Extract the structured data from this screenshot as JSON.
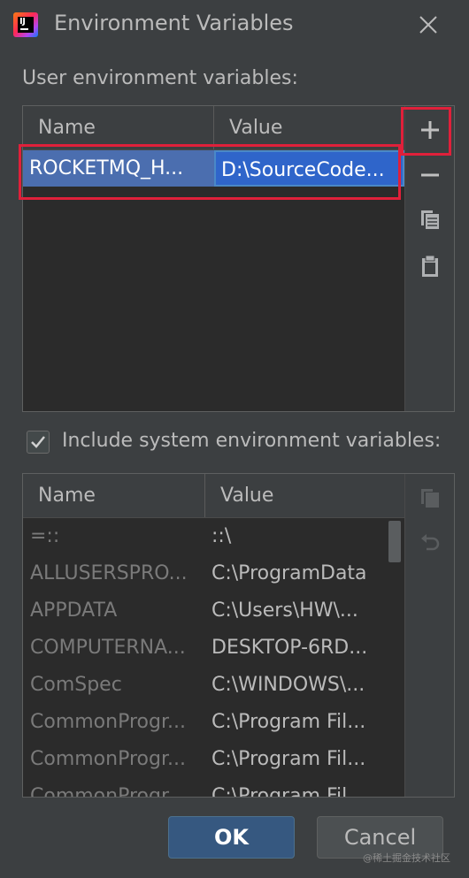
{
  "window": {
    "title": "Environment Variables",
    "logo_text": "IJ"
  },
  "user_section": {
    "label": "User environment variables:",
    "columns": [
      "Name",
      "Value"
    ],
    "rows": [
      {
        "name": "ROCKETMQ_H...",
        "value": "D:\\SourceCode..."
      }
    ]
  },
  "toolbar_icons": [
    "add-icon",
    "remove-icon",
    "copy-icon",
    "paste-icon"
  ],
  "include_system": {
    "label": "Include system environment variables:",
    "checked": true
  },
  "system_section": {
    "columns": [
      "Name",
      "Value"
    ],
    "rows": [
      {
        "name": "=::",
        "value": "::\\"
      },
      {
        "name": "ALLUSERSPRO...",
        "value": "C:\\ProgramData"
      },
      {
        "name": "APPDATA",
        "value": "C:\\Users\\HW\\..."
      },
      {
        "name": "COMPUTERNA...",
        "value": "DESKTOP-6RD..."
      },
      {
        "name": "ComSpec",
        "value": "C:\\WINDOWS\\..."
      },
      {
        "name": "CommonProgr...",
        "value": "C:\\Program Fil..."
      },
      {
        "name": "CommonProgr...",
        "value": "C:\\Program Fil..."
      },
      {
        "name": "CommonProgr...",
        "value": "C:\\Program Fil..."
      }
    ]
  },
  "buttons": {
    "ok": "OK",
    "cancel": "Cancel"
  },
  "watermark": "@稀土掘金技术社区",
  "colors": {
    "background": "#3c3f41",
    "selection": "#4b6eaf",
    "annotation": "#e0203a",
    "ok_button": "#365880"
  }
}
